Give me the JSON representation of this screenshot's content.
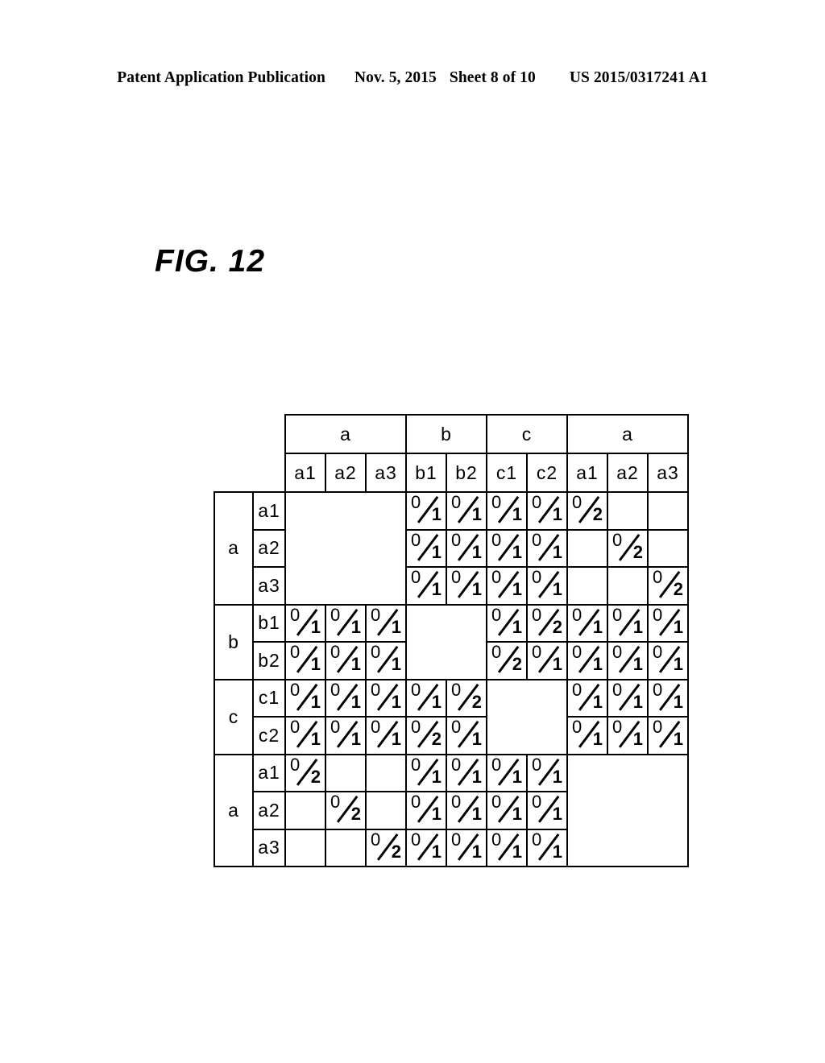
{
  "patent_header": {
    "publication": "Patent Application Publication",
    "date": "Nov. 5, 2015",
    "sheet": "Sheet 8 of 10",
    "number": "US 2015/0317241 A1"
  },
  "figure": {
    "caption": "FIG. 12"
  },
  "matrix": {
    "column_groups": [
      {
        "label": "a",
        "span": 3
      },
      {
        "label": "b",
        "span": 2
      },
      {
        "label": "c",
        "span": 2
      },
      {
        "label": "a",
        "span": 3
      }
    ],
    "column_headers": [
      "a1",
      "a2",
      "a3",
      "b1",
      "b2",
      "c1",
      "c2",
      "a1",
      "a2",
      "a3"
    ],
    "row_groups": [
      {
        "label": "a",
        "span": 3
      },
      {
        "label": "b",
        "span": 2
      },
      {
        "label": "c",
        "span": 2
      },
      {
        "label": "a",
        "span": 3
      }
    ],
    "row_headers": [
      "a1",
      "a2",
      "a3",
      "b1",
      "b2",
      "c1",
      "c2",
      "a1",
      "a2",
      "a3"
    ],
    "cell_values": [
      [
        "hatch",
        "hatch",
        "hatch",
        "0/1",
        "0/1",
        "0/1",
        "0/1",
        "0/2",
        "",
        ""
      ],
      [
        "hatch",
        "hatch",
        "hatch",
        "0/1",
        "0/1",
        "0/1",
        "0/1",
        "",
        "0/2",
        ""
      ],
      [
        "hatch",
        "hatch",
        "hatch",
        "0/1",
        "0/1",
        "0/1",
        "0/1",
        "",
        "",
        "0/2"
      ],
      [
        "0/1",
        "0/1",
        "0/1",
        "hatch",
        "hatch",
        "0/1",
        "0/2",
        "0/1",
        "0/1",
        "0/1"
      ],
      [
        "0/1",
        "0/1",
        "0/1",
        "hatch",
        "hatch",
        "0/2",
        "0/1",
        "0/1",
        "0/1",
        "0/1"
      ],
      [
        "0/1",
        "0/1",
        "0/1",
        "0/1",
        "0/2",
        "hatch",
        "hatch",
        "0/1",
        "0/1",
        "0/1"
      ],
      [
        "0/1",
        "0/1",
        "0/1",
        "0/2",
        "0/1",
        "hatch",
        "hatch",
        "0/1",
        "0/1",
        "0/1"
      ],
      [
        "0/2",
        "",
        "",
        "0/1",
        "0/1",
        "0/1",
        "0/1",
        "hatch",
        "hatch",
        "hatch"
      ],
      [
        "",
        "0/2",
        "",
        "0/1",
        "0/1",
        "0/1",
        "0/1",
        "hatch",
        "hatch",
        "hatch"
      ],
      [
        "",
        "",
        "0/2",
        "0/1",
        "0/1",
        "0/1",
        "0/1",
        "hatch",
        "hatch",
        "hatch"
      ]
    ],
    "hatch_blocks": [
      {
        "row": 0,
        "col": 0,
        "rowspan": 3,
        "colspan": 3
      },
      {
        "row": 3,
        "col": 3,
        "rowspan": 2,
        "colspan": 2
      },
      {
        "row": 5,
        "col": 5,
        "rowspan": 2,
        "colspan": 2
      },
      {
        "row": 7,
        "col": 7,
        "rowspan": 3,
        "colspan": 3
      }
    ]
  }
}
